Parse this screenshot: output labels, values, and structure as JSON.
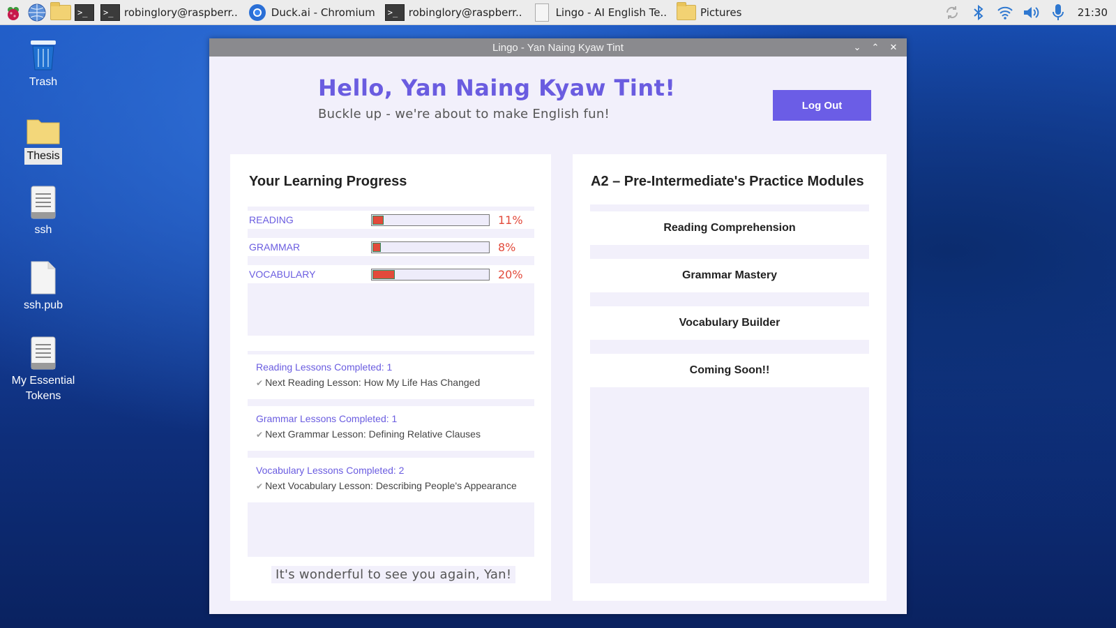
{
  "taskbar": {
    "tasks": [
      {
        "label": "robinglory@raspberr..",
        "icon": "terminal-icon"
      },
      {
        "label": "Duck.ai - Chromium",
        "icon": "chromium-icon"
      },
      {
        "label": "robinglory@raspberr..",
        "icon": "terminal-icon"
      },
      {
        "label": "Lingo - AI English Te..",
        "icon": "document-icon"
      },
      {
        "label": "Pictures",
        "icon": "folder-icon"
      }
    ],
    "clock": "21:30"
  },
  "desktop": {
    "items": [
      {
        "label": "Trash",
        "icon": "trash-icon"
      },
      {
        "label": "Thesis",
        "icon": "folder-icon"
      },
      {
        "label": "ssh",
        "icon": "text-file-icon"
      },
      {
        "label": "ssh.pub",
        "icon": "file-icon"
      },
      {
        "label": "My Essential Tokens",
        "icon": "text-file-icon"
      }
    ]
  },
  "window": {
    "title": "Lingo - Yan Naing Kyaw Tint",
    "greeting": "Hello, Yan Naing Kyaw Tint!",
    "subtitle": "Buckle up - we're about to make English fun!",
    "logout_label": "Log Out",
    "progress": {
      "heading": "Your Learning Progress",
      "rows": [
        {
          "label": "READING",
          "percent": 11,
          "percent_text": "11%"
        },
        {
          "label": "GRAMMAR",
          "percent": 8,
          "percent_text": "8%"
        },
        {
          "label": "VOCABULARY",
          "percent": 20,
          "percent_text": "20%"
        }
      ]
    },
    "lessons": [
      {
        "completed": "Reading Lessons Completed: 1",
        "next": "Next Reading Lesson: How My Life Has Changed"
      },
      {
        "completed": "Grammar Lessons Completed: 1",
        "next": "Next Grammar Lesson: Defining Relative Clauses"
      },
      {
        "completed": "Vocabulary Lessons Completed: 2",
        "next": "Next Vocabulary Lesson: Describing People's Appearance"
      }
    ],
    "welcome": "It's wonderful to see you again, Yan!",
    "modules": {
      "heading": "A2 – Pre-Intermediate's Practice Modules",
      "items": [
        "Reading Comprehension",
        "Grammar Mastery",
        "Vocabulary Builder",
        "Coming Soon!!"
      ]
    }
  },
  "colors": {
    "accent": "#6b5de6",
    "progress_fill": "#e24a3b",
    "panel_bg": "#f2f0fb"
  }
}
